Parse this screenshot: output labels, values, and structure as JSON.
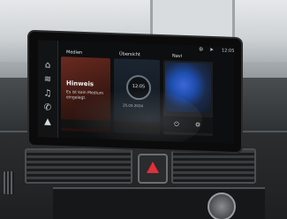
{
  "screen": {
    "status_time": "12:05",
    "tiles": {
      "media": {
        "label": "Medien",
        "title": "Hinweis",
        "message": "Es ist kein Medium eingelegt."
      },
      "overview": {
        "label": "Übersicht",
        "time": "12:05",
        "date": "25.03.2024"
      },
      "navigation": {
        "label": "Navi"
      }
    }
  },
  "icons": [
    "home-icon",
    "media-icon",
    "music-icon",
    "phone-icon",
    "nav-icon",
    "gear-icon",
    "arrow-icon"
  ],
  "colors": {
    "hazard_red": "#e0303a",
    "screen_black": "#0d0e10",
    "map_blue": "#3c66d8"
  }
}
